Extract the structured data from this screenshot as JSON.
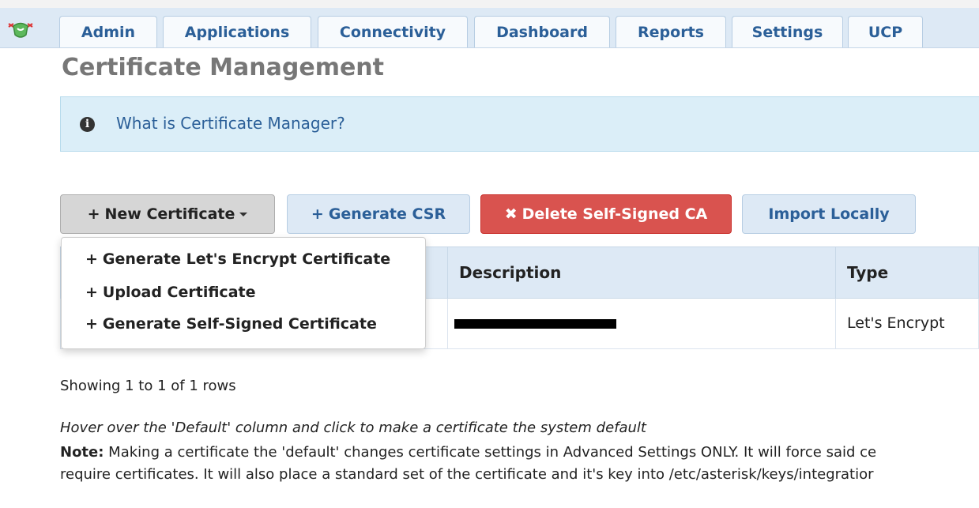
{
  "nav": {
    "tabs": [
      "Admin",
      "Applications",
      "Connectivity",
      "Dashboard",
      "Reports",
      "Settings",
      "UCP"
    ]
  },
  "page": {
    "title": "Certificate Management"
  },
  "info": {
    "text": "What is Certificate Manager?",
    "icon": "info-circle-icon"
  },
  "toolbar": {
    "new_certificate": "New Certificate",
    "generate_csr": "Generate CSR",
    "delete_ca": "Delete Self-Signed CA",
    "import_locally": "Import Locally"
  },
  "dropdown": {
    "items": [
      "Generate Let's Encrypt Certificate",
      "Upload Certificate",
      "Generate Self-Signed Certificate"
    ]
  },
  "table": {
    "headers": [
      "",
      "Description",
      "Type"
    ],
    "rows": [
      {
        "description": "[redacted]",
        "type": "Let's Encrypt"
      }
    ]
  },
  "footer": {
    "showing": "Showing 1 to 1 of 1 rows",
    "hint": "Hover over the 'Default' column and click to make a certificate the system default",
    "note_label": "Note:",
    "note_line1": " Making a certificate the 'default' changes certificate settings in Advanced Settings ONLY. It will force said ce",
    "note_line2": "require certificates. It will also place a standard set of the certificate and it's key into /etc/asterisk/keys/integratior"
  },
  "colors": {
    "nav_bg": "#dde9f5",
    "tab_text": "#2b5f98",
    "danger": "#d9534f",
    "info_bg": "#dbeef8"
  }
}
